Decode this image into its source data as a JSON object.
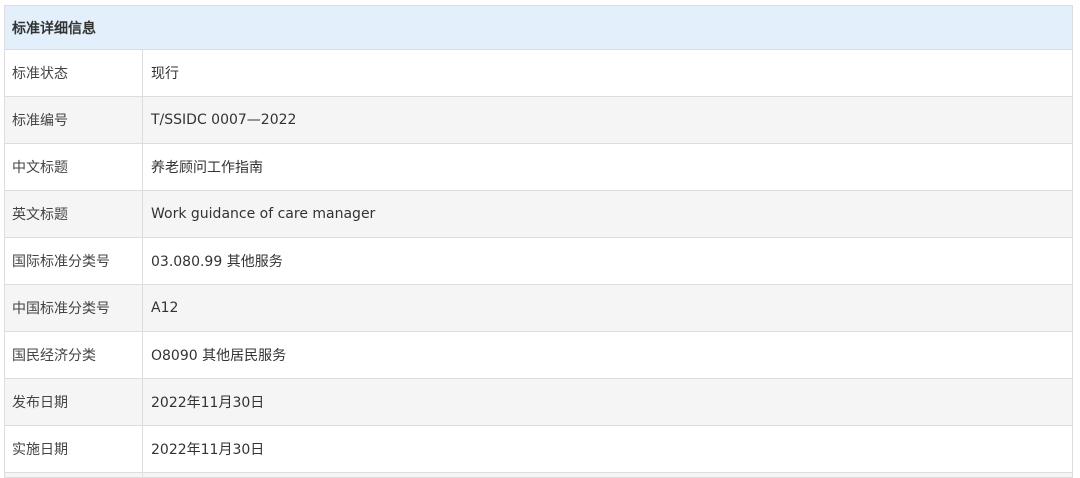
{
  "table": {
    "header": "标准详细信息",
    "rows": [
      {
        "label": "标准状态",
        "value": "现行"
      },
      {
        "label": "标准编号",
        "value": "T/SSIDC 0007—2022"
      },
      {
        "label": "中文标题",
        "value": "养老顾问工作指南"
      },
      {
        "label": "英文标题",
        "value": "Work guidance of care manager"
      },
      {
        "label": "国际标准分类号",
        "value": "03.080.99 其他服务"
      },
      {
        "label": "中国标准分类号",
        "value": "A12"
      },
      {
        "label": "国民经济分类",
        "value": "O8090 其他居民服务"
      },
      {
        "label": "发布日期",
        "value": "2022年11月30日"
      },
      {
        "label": "实施日期",
        "value": "2022年11月30日"
      }
    ]
  }
}
